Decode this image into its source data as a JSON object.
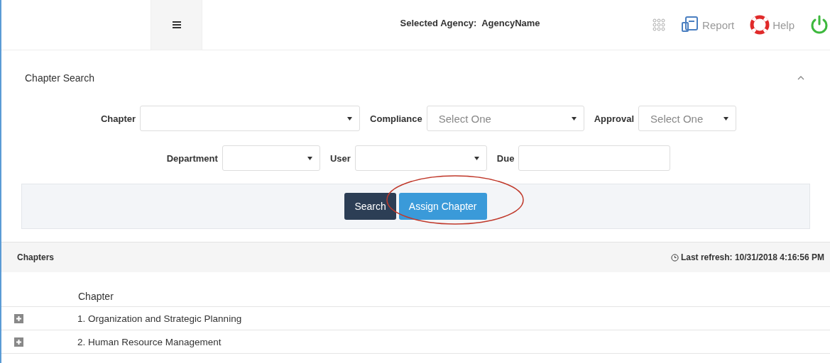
{
  "header": {
    "agency_label": "Selected Agency:",
    "agency_name": "AgencyName",
    "links": [
      {
        "kind": "apps"
      },
      {
        "kind": "report",
        "label": "Report"
      },
      {
        "kind": "help",
        "label": "Help"
      },
      {
        "kind": "power"
      }
    ]
  },
  "search_panel": {
    "title": "Chapter Search",
    "expanded": true,
    "rows": [
      [
        {
          "label": "Chapter",
          "kind": "select"
        },
        {
          "label": "Compliance",
          "kind": "select",
          "value": "Select One"
        },
        {
          "label": "Approval",
          "kind": "select",
          "value": "Select One"
        }
      ],
      [
        {
          "label": "Department",
          "kind": "select"
        },
        {
          "label": "User",
          "kind": "select"
        },
        {
          "label": "Due",
          "kind": "input"
        }
      ]
    ],
    "buttons": [
      {
        "label": "Search",
        "kind": "primary"
      },
      {
        "label": "Assign Chapter",
        "kind": "info",
        "highlighted": true
      }
    ]
  },
  "chapters": {
    "title": "Chapters",
    "refresh": "Last refresh: 10/31/2018 4:16:56 PM",
    "column": "Chapter",
    "rows": [
      {
        "label": "1. Organization and Strategic Planning",
        "expanded": false
      },
      {
        "label": "2. Human Resource Management",
        "expanded": false
      }
    ]
  }
}
